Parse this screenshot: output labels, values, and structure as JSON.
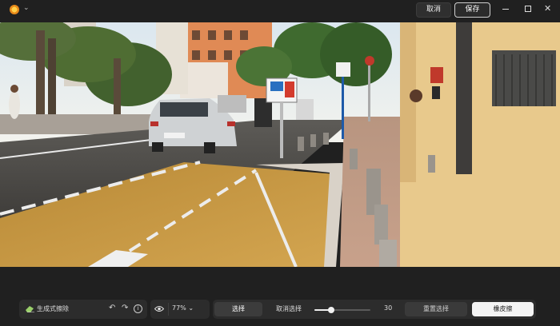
{
  "header": {
    "cancel_label": "取消",
    "save_label": "保存"
  },
  "toolbar": {
    "tool_name": "生成式擦除",
    "zoom": "77%",
    "tab_select": "选择",
    "tab_deselect": "取消选择",
    "brush_size": 30,
    "brush_size_label": "30",
    "brush_size_max": 100,
    "reset_label": "重置选择",
    "eraser_label": "橡皮擦"
  },
  "colors": {
    "background": "#202020",
    "panel": "#2c2c2c",
    "active_tab": "#3c3c3c",
    "primary_button": "#f4f4f4"
  },
  "icons": {
    "app": "sun-icon",
    "tool": "eraser-icon",
    "undo": "undo-icon",
    "redo": "redo-icon",
    "info": "info-icon",
    "visibility": "eye-icon"
  }
}
